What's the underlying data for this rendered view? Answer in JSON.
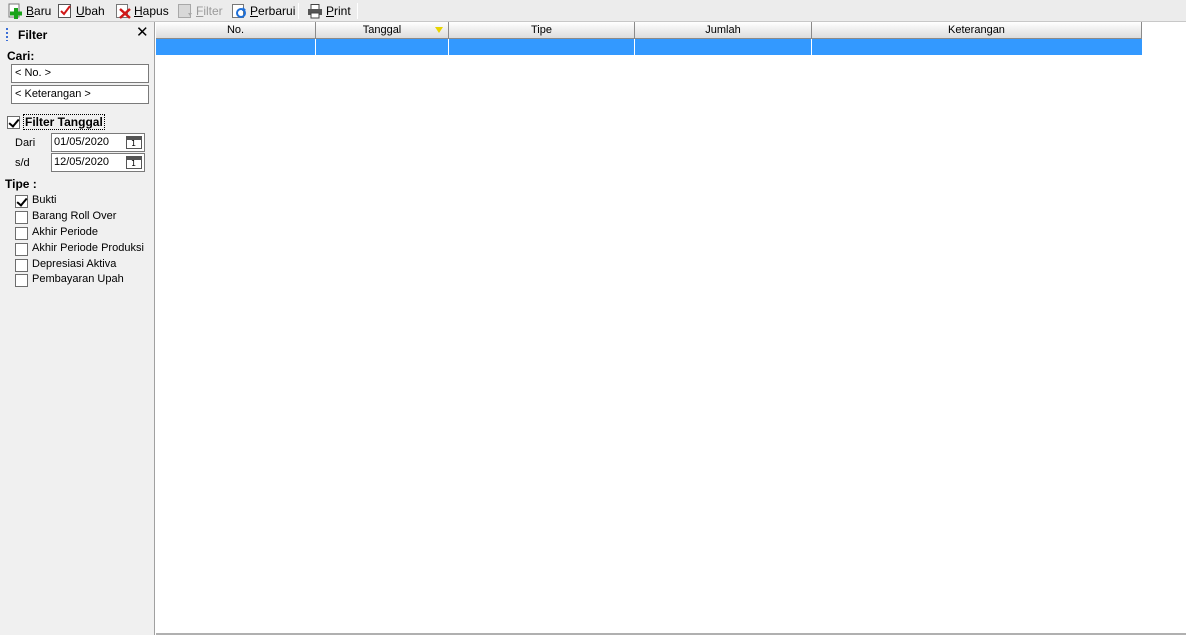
{
  "toolbar": {
    "buttons": [
      {
        "label": "Baru",
        "icon": "add-icon",
        "enabled": true
      },
      {
        "label": "Ubah",
        "icon": "edit-check-icon",
        "enabled": true
      },
      {
        "label": "Hapus",
        "icon": "delete-icon",
        "enabled": true
      },
      {
        "label": "Filter",
        "icon": "filter-icon",
        "enabled": false
      },
      {
        "label": "Perbarui",
        "icon": "refresh-icon",
        "enabled": true
      },
      {
        "label": "Print",
        "icon": "printer-icon",
        "enabled": true
      }
    ]
  },
  "filter_panel": {
    "title": "Filter",
    "search_label": "Cari:",
    "search_fields": [
      "< No. >",
      "< Keterangan >"
    ],
    "filter_date": {
      "label": "Filter Tanggal",
      "checked": true,
      "from_label": "Dari",
      "from_value": "01/05/2020",
      "to_label": "s/d",
      "to_value": "12/05/2020"
    },
    "type_label": "Tipe :",
    "types": [
      {
        "label": "Bukti",
        "checked": true
      },
      {
        "label": "Barang Roll Over",
        "checked": false
      },
      {
        "label": "Akhir Periode",
        "checked": false
      },
      {
        "label": "Akhir Periode Produksi",
        "checked": false
      },
      {
        "label": "Depresiasi Aktiva",
        "checked": false
      },
      {
        "label": "Pembayaran Upah",
        "checked": false
      }
    ]
  },
  "grid": {
    "columns": [
      "No.",
      "Tanggal",
      "Tipe",
      "Jumlah",
      "Keterangan"
    ],
    "sorted_column": "Tanggal",
    "selected_row_color": "#3399ff",
    "rows": []
  }
}
